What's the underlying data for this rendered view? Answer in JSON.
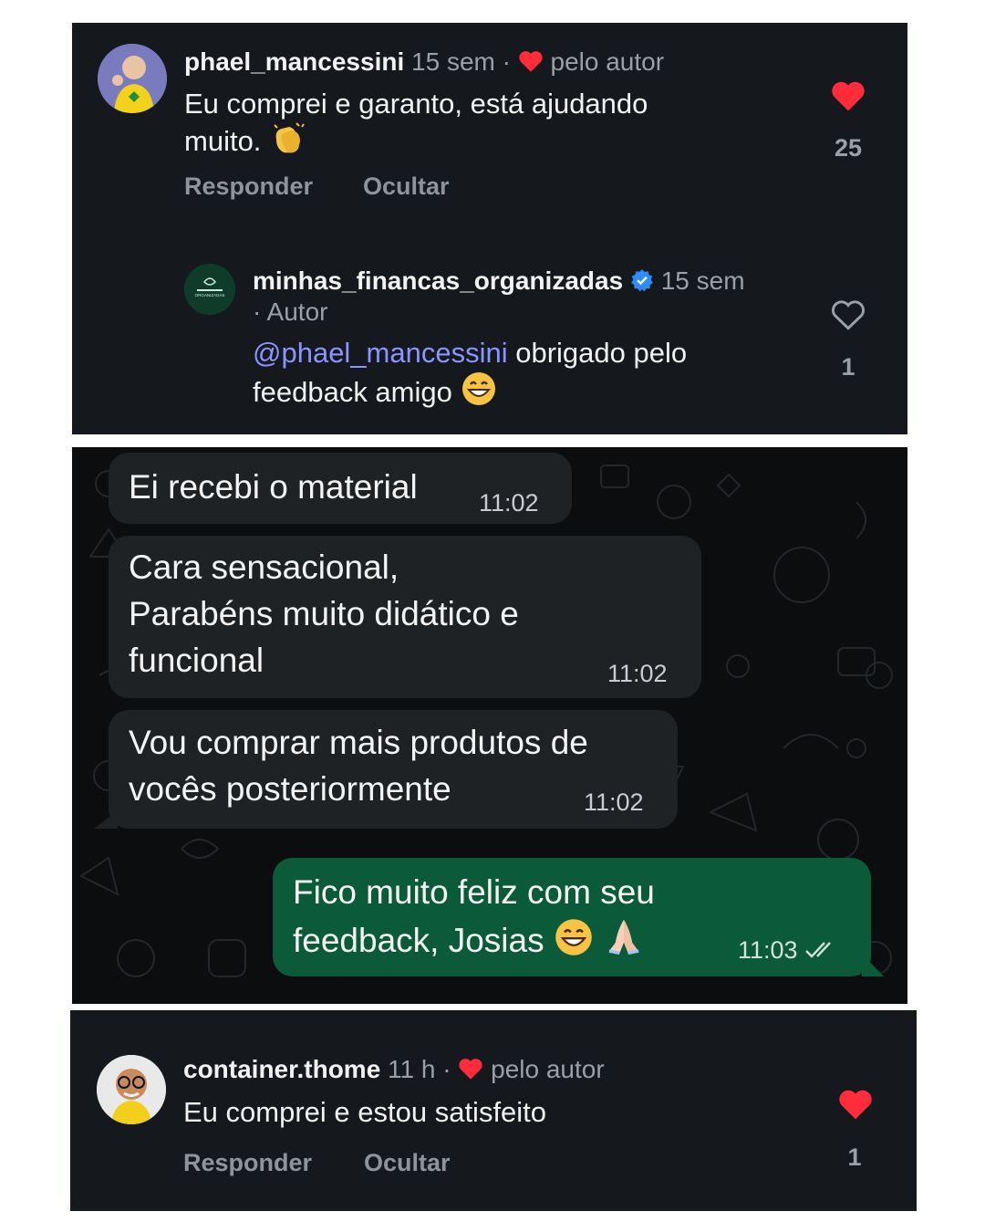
{
  "comment1": {
    "username": "phael_mancessini",
    "time": "15 sem",
    "sep": "·",
    "liked_by_author": "pelo autor",
    "text_line1": "Eu comprei e garanto, está ajudando",
    "text_line2": "muito.",
    "like_count": "25",
    "actions": {
      "reply": "Responder",
      "hide": "Ocultar"
    }
  },
  "reply1": {
    "username": "minhas_financas_organizadas",
    "time": "15 sem",
    "role": "· Autor",
    "mention": "@phael_mancessini",
    "text_line1_rest": " obrigado pelo",
    "text_line2": "feedback amigo",
    "like_count": "1",
    "avatar_text": "ORGANIZADAS"
  },
  "chat": {
    "messages": [
      {
        "lines": [
          "Ei recebi o material"
        ],
        "time": "11:02",
        "direction": "in"
      },
      {
        "lines": [
          "Cara sensacional,",
          "Parabéns muito didático e",
          "funcional"
        ],
        "time": "11:02",
        "direction": "in"
      },
      {
        "lines": [
          "Vou comprar mais produtos de",
          "vocês posteriormente"
        ],
        "time": "11:02",
        "direction": "in"
      },
      {
        "lines": [
          "Fico muito feliz com seu",
          "feedback, Josias"
        ],
        "time": "11:03",
        "direction": "out",
        "status": "read"
      }
    ]
  },
  "comment2": {
    "username": "container.thome",
    "time": "11 h",
    "sep": "·",
    "liked_by_author": "pelo autor",
    "text": "Eu comprei e estou satisfeito",
    "like_count": "1",
    "actions": {
      "reply": "Responder",
      "hide": "Ocultar"
    }
  },
  "colors": {
    "panel_bg": "#15181c",
    "heart_red": "#ff2d3b",
    "verified_blue": "#2f8cf5",
    "mention_blue": "#8b95ff",
    "incoming_bubble": "#1f2225",
    "outgoing_bubble": "#0b5a3a"
  },
  "icons": [
    "heart-icon",
    "heart-outline-icon",
    "verified-badge-icon",
    "double-check-icon",
    "clap-emoji-icon",
    "grin-emoji-icon",
    "pray-emoji-icon"
  ]
}
